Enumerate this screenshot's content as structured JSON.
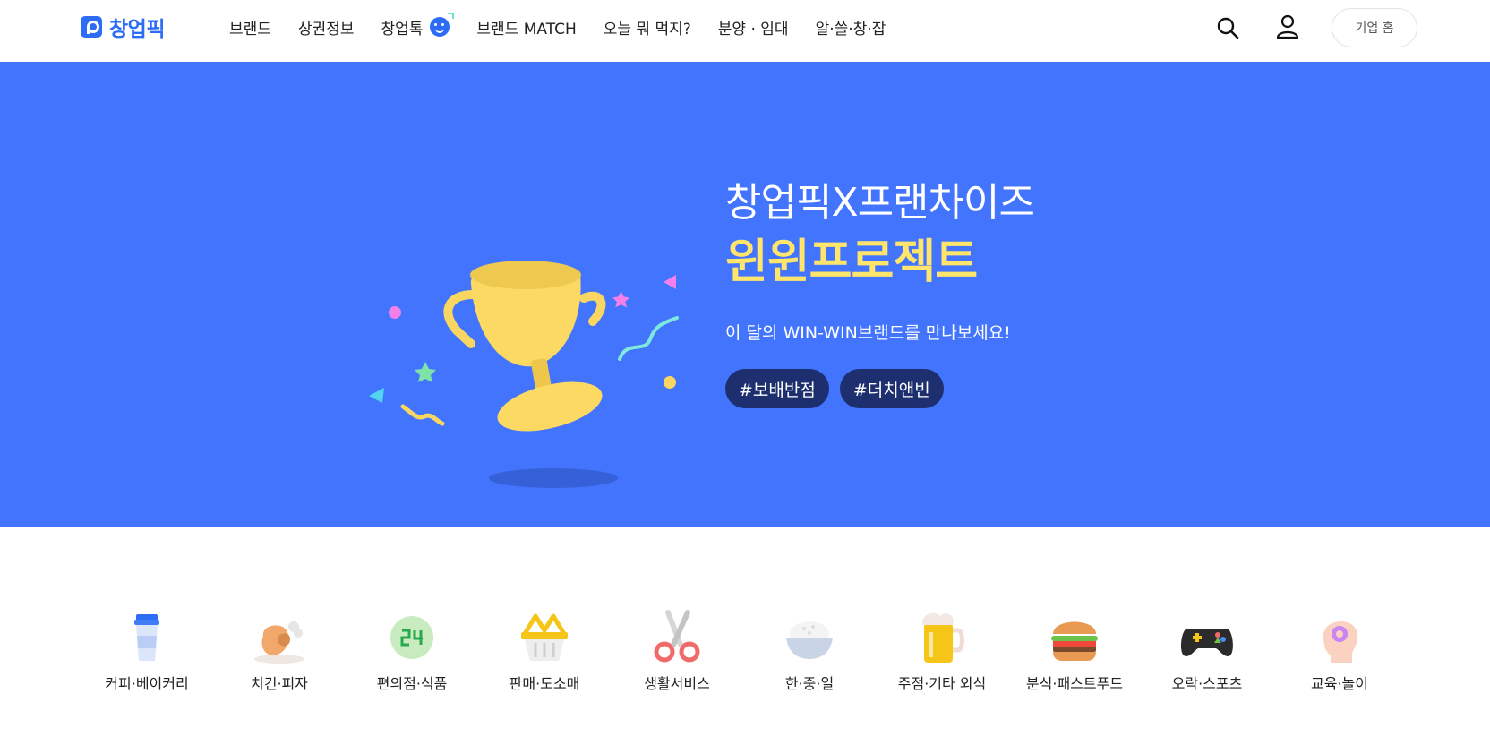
{
  "header": {
    "logo_text": "창업픽",
    "nav": [
      "브랜드",
      "상권정보",
      "창업톡",
      "브랜드 MATCH",
      "오늘 뭐 먹지?",
      "분양 · 임대",
      "알·쓸·창·잡"
    ],
    "corp_button": "기업 홈",
    "icons": {
      "search": "search-icon",
      "user": "user-icon",
      "talk_badge": "chat-face-icon"
    }
  },
  "banner": {
    "line1": "창업픽X프랜차이즈",
    "line2": "윈윈프로젝트",
    "sub": "이 달의 WIN-WIN브랜드를 만나보세요!",
    "tags": [
      "#보배반점",
      "#더치앤빈"
    ],
    "colors": {
      "background": "#4274fe",
      "highlight": "#ffe56b",
      "tag_bg": "#1d2f6e"
    }
  },
  "categories": [
    {
      "label": "커피·베이커리",
      "icon": "coffee-cup-icon"
    },
    {
      "label": "치킨·피자",
      "icon": "chicken-icon"
    },
    {
      "label": "편의점·식품",
      "icon": "convenience-store-24-icon"
    },
    {
      "label": "판매·도소매",
      "icon": "shopping-basket-icon"
    },
    {
      "label": "생활서비스",
      "icon": "scissors-icon"
    },
    {
      "label": "한·중·일",
      "icon": "rice-bowl-icon"
    },
    {
      "label": "주점·기타 외식",
      "icon": "beer-mug-icon"
    },
    {
      "label": "분식·패스트푸드",
      "icon": "hamburger-icon"
    },
    {
      "label": "오락·스포츠",
      "icon": "game-controller-icon"
    },
    {
      "label": "교육·놀이",
      "icon": "brain-head-icon"
    }
  ]
}
